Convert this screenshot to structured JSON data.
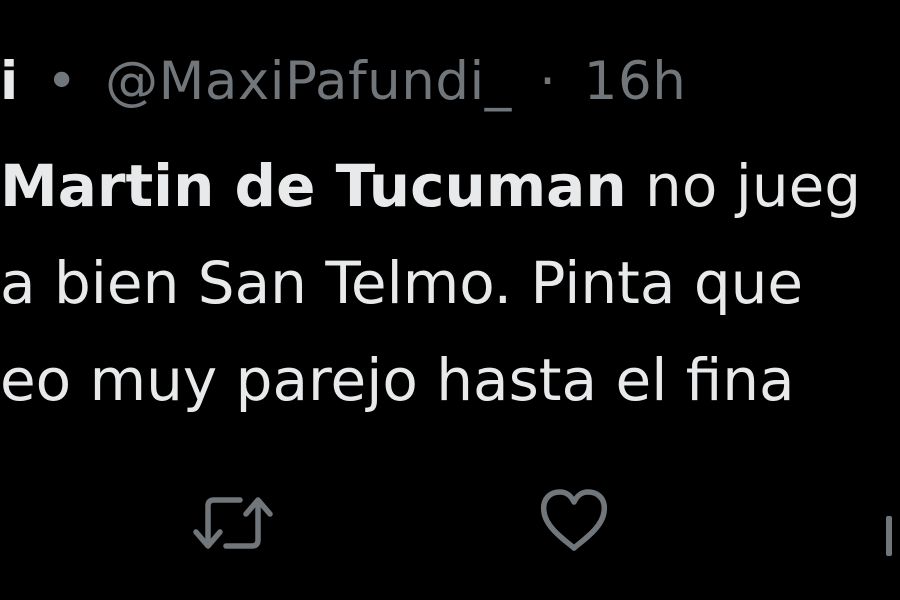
{
  "tweet": {
    "author_name_fragment": "i",
    "separator": "•",
    "handle": "@MaxiPafundi_",
    "time_separator": "·",
    "time": "16h",
    "text": {
      "line1_bold": "Martin de Tucuman",
      "line1_rest": " no jueg",
      "line2": "a bien San Telmo. Pinta que",
      "line3": "eo muy parejo hasta el fina"
    }
  },
  "icons": {
    "retweet": "retweet-icon",
    "like": "heart-icon",
    "more": "share-icon"
  }
}
